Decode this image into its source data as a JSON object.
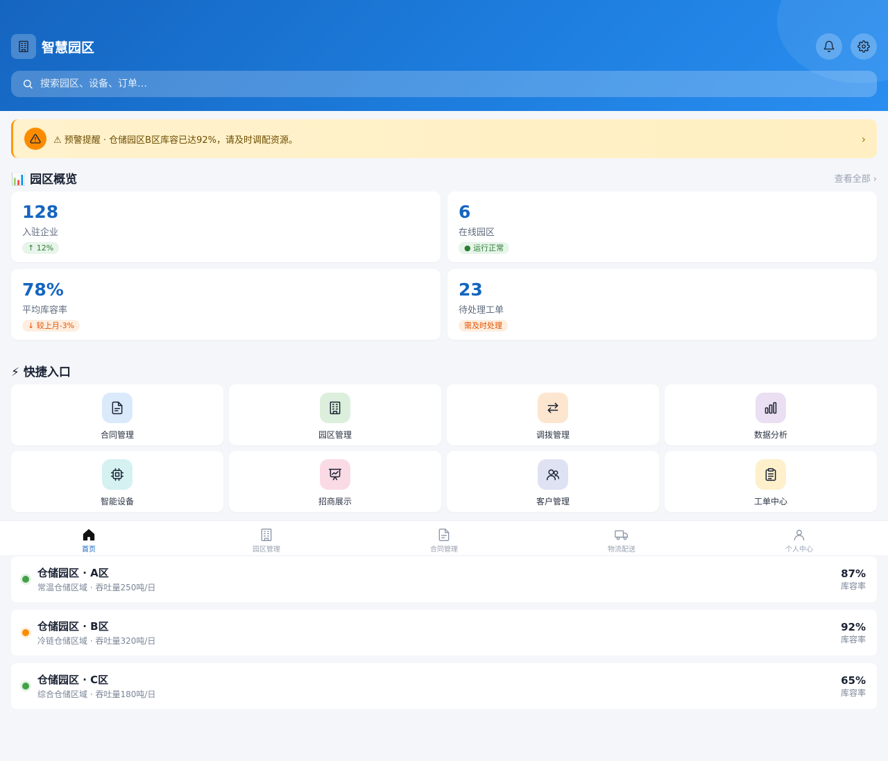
{
  "header": {
    "title": "智慧园区",
    "search_placeholder": "搜索园区、设备、订单…"
  },
  "alert": {
    "text": "⚠ 预警提醒 · 仓储园区B区库容已达92%，请及时调配资源。",
    "chevron": "›"
  },
  "overview": {
    "title": "📊 园区概览",
    "more": "查看全部 ›",
    "stats": [
      {
        "value": "128",
        "label": "入驻企业",
        "badge": "↑ 12%",
        "badge_color": "green"
      },
      {
        "value": "6",
        "label": "在线园区",
        "badge": "● 运行正常",
        "badge_color": "green"
      },
      {
        "value": "78%",
        "label": "平均库容率",
        "badge": "↓ 较上月-3%",
        "badge_color": "orange"
      },
      {
        "value": "23",
        "label": "待处理工单",
        "badge": "需及时处理",
        "badge_color": "orange"
      }
    ]
  },
  "quick_entries": {
    "title": "⚡ 快捷入口",
    "items": [
      {
        "label": "合同管理",
        "icon": "document-icon",
        "bg": "#dbeafb"
      },
      {
        "label": "园区管理",
        "icon": "building-icon",
        "bg": "#dcefdc"
      },
      {
        "label": "调拨管理",
        "icon": "transfer-icon",
        "bg": "#fde6cf"
      },
      {
        "label": "数据分析",
        "icon": "bar-chart-icon",
        "bg": "#ebdff3"
      },
      {
        "label": "智能设备",
        "icon": "chip-icon",
        "bg": "#d5f1f2"
      },
      {
        "label": "招商展示",
        "icon": "presentation-icon",
        "bg": "#fadbe5"
      },
      {
        "label": "客户管理",
        "icon": "users-icon",
        "bg": "#dfe2f3"
      },
      {
        "label": "工单中心",
        "icon": "clipboard-icon",
        "bg": "#fdf0cb"
      }
    ]
  },
  "bottom_nav": [
    {
      "label": "首页",
      "icon": "home-icon",
      "active": true
    },
    {
      "label": "园区管理",
      "icon": "building-icon",
      "active": false
    },
    {
      "label": "合同管理",
      "icon": "document-icon",
      "active": false
    },
    {
      "label": "物流配送",
      "icon": "truck-icon",
      "active": false
    },
    {
      "label": "个人中心",
      "icon": "user-icon",
      "active": false
    }
  ],
  "warehouses": [
    {
      "title": "仓储园区 · A区",
      "sub": "常温仓储区域 · 吞吐量250吨/日",
      "pct": "87%",
      "pct_label": "库容率",
      "status_color": "#43a047"
    },
    {
      "title": "仓储园区 · B区",
      "sub": "冷链仓储区域 · 吞吐量320吨/日",
      "pct": "92%",
      "pct_label": "库容率",
      "status_color": "#fb8c00"
    },
    {
      "title": "仓储园区 · C区",
      "sub": "综合仓储区域 · 吞吐量180吨/日",
      "pct": "65%",
      "pct_label": "库容率",
      "status_color": "#43a047"
    }
  ]
}
